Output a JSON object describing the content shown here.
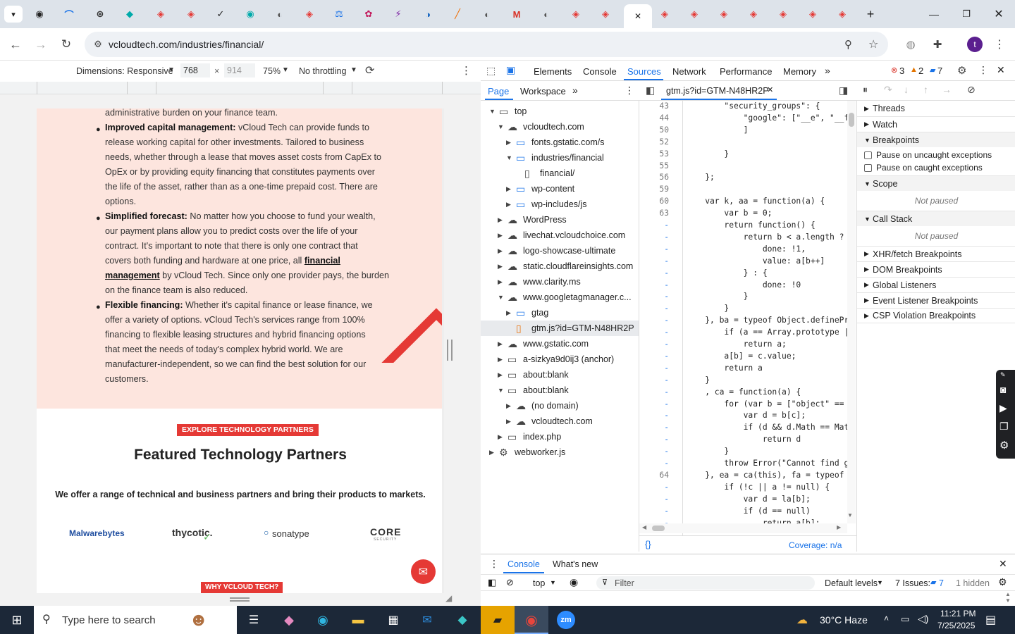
{
  "browser": {
    "url": "vcloudtech.com/industries/financial/",
    "active_tab_close": "✕"
  },
  "device_toolbar": {
    "dimensions_label": "Dimensions: Responsive",
    "width": "768",
    "height": "914",
    "zoom": "75%",
    "throttling": "No throttling"
  },
  "page": {
    "lead_line": "administrative burden on your finance team.",
    "bullets": [
      {
        "title": "Improved capital management:",
        "lines": [
          " vCloud Tech can provide funds to",
          "release working capital for other investments. Tailored to business",
          "needs, whether through a lease that moves asset costs from CapEx to",
          "OpEx or by providing equity financing that constitutes payments over",
          "the life of the asset, rather than as a one-time prepaid cost. There are",
          "options."
        ]
      },
      {
        "title": "Simplified forecast:",
        "lines": [
          " No matter how you choose to fund your wealth,",
          "our payment plans allow you to predict costs over the life of your",
          "contract. It's important to note that there is only one contract that",
          "covers both funding and hardware at one price, all ",
          "management",
          " by vCloud Tech. Since only one provider pays, the burden",
          "on the finance team is also reduced."
        ],
        "link": "financial"
      },
      {
        "title": "Flexible financing:",
        "lines": [
          " Whether it's capital finance or lease finance, we",
          "offer a variety of options. vCloud Tech's services range from 100%",
          "financing to flexible leasing structures and hybrid financing options",
          "that meet the needs of today's complex hybrid world. We are",
          "manufacturer-independent, so we can find the best solution for our",
          "customers."
        ]
      }
    ],
    "badge": "EXPLORE TECHNOLOGY PARTNERS",
    "heading": "Featured Technology Partners",
    "subheading": "We offer a range of technical and business partners and bring their products to markets.",
    "partners": [
      "Malwarebytes",
      "thycotic.",
      "sonatype",
      "CORE"
    ],
    "partner_core_sub": "SECURITY",
    "badge2": "WHY VCLOUD TECH?"
  },
  "devtools": {
    "tabs": [
      "Elements",
      "Console",
      "Sources",
      "Network",
      "Performance",
      "Memory"
    ],
    "active_tab": "Sources",
    "errors": "3",
    "warnings": "2",
    "messages": "7",
    "nav_tabs": [
      "Page",
      "Workspace"
    ],
    "file_tab": "gtm.js?id=GTM-N48HR2P",
    "tree": [
      {
        "label": "top",
        "indent": 0,
        "arrow": "▼",
        "icon": "frame"
      },
      {
        "label": "vcloudtech.com",
        "indent": 1,
        "arrow": "▼",
        "icon": "cloud"
      },
      {
        "label": "fonts.gstatic.com/s",
        "indent": 2,
        "arrow": "▶",
        "icon": "folder"
      },
      {
        "label": "industries/financial",
        "indent": 2,
        "arrow": "▼",
        "icon": "folder"
      },
      {
        "label": "financial/",
        "indent": 3,
        "arrow": "",
        "icon": "file"
      },
      {
        "label": "wp-content",
        "indent": 2,
        "arrow": "▶",
        "icon": "folder"
      },
      {
        "label": "wp-includes/js",
        "indent": 2,
        "arrow": "▶",
        "icon": "folder"
      },
      {
        "label": "WordPress",
        "indent": 1,
        "arrow": "▶",
        "icon": "cloud"
      },
      {
        "label": "livechat.vcloudchoice.com",
        "indent": 1,
        "arrow": "▶",
        "icon": "cloud"
      },
      {
        "label": "logo-showcase-ultimate",
        "indent": 1,
        "arrow": "▶",
        "icon": "cloud"
      },
      {
        "label": "static.cloudflareinsights.com",
        "indent": 1,
        "arrow": "▶",
        "icon": "cloud"
      },
      {
        "label": "www.clarity.ms",
        "indent": 1,
        "arrow": "▶",
        "icon": "cloud"
      },
      {
        "label": "www.googletagmanager.c...",
        "indent": 1,
        "arrow": "▼",
        "icon": "cloud"
      },
      {
        "label": "gtag",
        "indent": 2,
        "arrow": "▶",
        "icon": "folder"
      },
      {
        "label": "gtm.js?id=GTM-N48HR2P",
        "indent": 2,
        "arrow": "",
        "icon": "file-js",
        "selected": true
      },
      {
        "label": "www.gstatic.com",
        "indent": 1,
        "arrow": "▶",
        "icon": "cloud"
      },
      {
        "label": "a-sizkya9d0ij3 (anchor)",
        "indent": 1,
        "arrow": "▶",
        "icon": "frame"
      },
      {
        "label": "about:blank",
        "indent": 1,
        "arrow": "▶",
        "icon": "frame"
      },
      {
        "label": "about:blank",
        "indent": 1,
        "arrow": "▼",
        "icon": "frame"
      },
      {
        "label": "(no domain)",
        "indent": 2,
        "arrow": "▶",
        "icon": "cloud"
      },
      {
        "label": "vcloudtech.com",
        "indent": 2,
        "arrow": "▶",
        "icon": "cloud"
      },
      {
        "label": "index.php",
        "indent": 1,
        "arrow": "▶",
        "icon": "frame"
      },
      {
        "label": "webworker.js",
        "indent": 0,
        "arrow": "▶",
        "icon": "gear"
      }
    ],
    "code_lines": [
      {
        "n": "43",
        "t": "        \"security_groups\": {"
      },
      {
        "n": "44",
        "t": "            \"google\": [\"__e\", \"__f\""
      },
      {
        "n": "50",
        "t": "            ]"
      },
      {
        "n": "52",
        "t": ""
      },
      {
        "n": "53",
        "t": "        }"
      },
      {
        "n": "55",
        "t": ""
      },
      {
        "n": "56",
        "t": "    };"
      },
      {
        "n": "59",
        "t": ""
      },
      {
        "n": "60",
        "t": "    var k, aa = function(a) {"
      },
      {
        "n": "63",
        "t": "        var b = 0;"
      },
      {
        "n": "-",
        "t": "        return function() {"
      },
      {
        "n": "-",
        "t": "            return b < a.length ? {"
      },
      {
        "n": "-",
        "t": "                done: !1,"
      },
      {
        "n": "-",
        "t": "                value: a[b++]"
      },
      {
        "n": "-",
        "t": "            } : {"
      },
      {
        "n": "-",
        "t": "                done: !0"
      },
      {
        "n": "-",
        "t": "            }"
      },
      {
        "n": "-",
        "t": "        }"
      },
      {
        "n": "-",
        "t": "    }, ba = typeof Object.definePro"
      },
      {
        "n": "-",
        "t": "        if (a == Array.prototype ||"
      },
      {
        "n": "-",
        "t": "            return a;"
      },
      {
        "n": "-",
        "t": "        a[b] = c.value;"
      },
      {
        "n": "-",
        "t": "        return a"
      },
      {
        "n": "-",
        "t": "    }"
      },
      {
        "n": "-",
        "t": "    , ca = function(a) {"
      },
      {
        "n": "-",
        "t": "        for (var b = [\"object\" == t"
      },
      {
        "n": "-",
        "t": "            var d = b[c];"
      },
      {
        "n": "-",
        "t": "            if (d && d.Math == Math"
      },
      {
        "n": "-",
        "t": "                return d"
      },
      {
        "n": "-",
        "t": "        }"
      },
      {
        "n": "-",
        "t": "        throw Error(\"Cannot find gl"
      },
      {
        "n": "64",
        "t": "    }, ea = ca(this), fa = typeof S"
      },
      {
        "n": "-",
        "t": "        if (!c || a != null) {"
      },
      {
        "n": "-",
        "t": "            var d = la[b];"
      },
      {
        "n": "-",
        "t": "            if (d == null)"
      },
      {
        "n": "-",
        "t": "                return a[b];"
      }
    ],
    "coverage": "Coverage: n/a",
    "right_sections": [
      {
        "label": "Threads",
        "arrow": "▶"
      },
      {
        "label": "Watch",
        "arrow": "▶"
      },
      {
        "label": "Breakpoints",
        "arrow": "▼"
      }
    ],
    "pause_uncaught": "Pause on uncaught exceptions",
    "pause_caught": "Pause on caught exceptions",
    "scope": "Scope",
    "not_paused": "Not paused",
    "call_stack": "Call Stack",
    "bp_sections": [
      "XHR/fetch Breakpoints",
      "DOM Breakpoints",
      "Global Listeners",
      "Event Listener Breakpoints",
      "CSP Violation Breakpoints"
    ],
    "drawer_tabs": [
      "Console",
      "What's new"
    ],
    "console_context": "top",
    "filter_placeholder": "Filter",
    "default_levels": "Default levels",
    "issues": "7 Issues:",
    "issues_count": "7",
    "hidden": "1 hidden"
  },
  "taskbar": {
    "search_placeholder": "Type here to search",
    "weather": "30°C  Haze",
    "time": "11:21 PM",
    "date": "7/25/2025"
  }
}
